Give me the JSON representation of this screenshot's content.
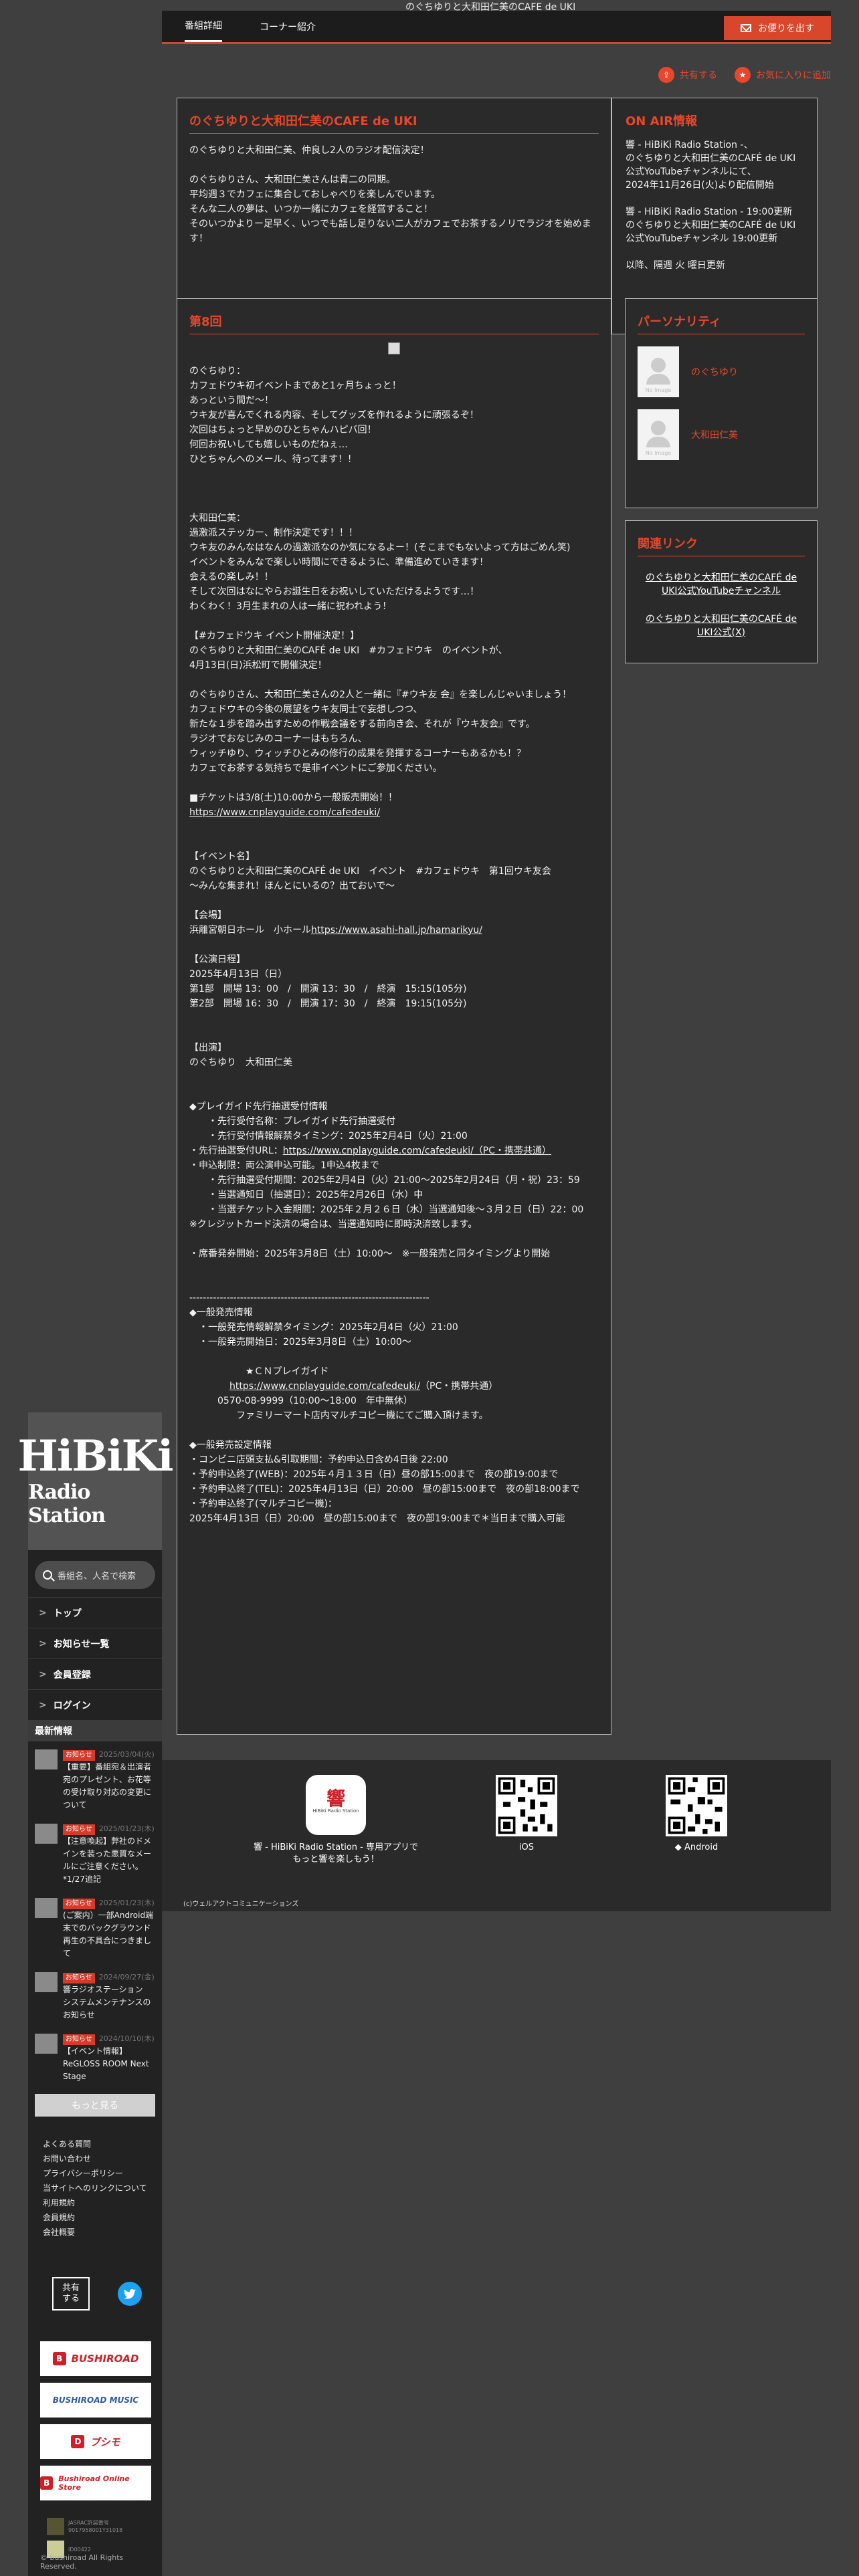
{
  "page": {
    "header_image_alt": "のぐちゆりと大和田仁美のCAFE de UKI"
  },
  "topnav": {
    "tabs": [
      "番組詳細",
      "コーナー紹介"
    ],
    "mail_button": "お便りを出す"
  },
  "actions": {
    "share": "共有する",
    "favorite": "お気に入りに追加"
  },
  "info": {
    "title": "のぐちゆりと大和田仁美のCAFE de UKI",
    "body": "のぐちゆりと大和田仁美、仲良し2人のラジオ配信決定！\n\nのぐちゆりさん、大和田仁美さんは青二の同期。\n平均週３でカフェに集合しておしゃべりを楽しんでいます。\nそんな二人の夢は、いつか一緒にカフェを経営すること！\nそのいつかよりー足早く、いつでも話し足りない二人がカフェでお茶するノリでラジオを始めます！"
  },
  "onair": {
    "title": "ON AIR情報",
    "body": "響 - HiBiKi Radio Station -、\nのぐちゆりと大和田仁美のCAFÉ de UKI公式YouTubeチャンネルにて、\n2024年11月26日(火)より配信開始\n\n響 - HiBiKi Radio Station - 19:00更新\nのぐちゆりと大和田仁美のCAFÉ de UKI公式YouTubeチャンネル 19:00更新\n\n以降、隔週 火 曜日更新"
  },
  "episode": {
    "title": "第8回",
    "block1": "のぐちゆり：\nカフェドウキ初イベントまであと1ヶ月ちょっと！\nあっという間だ〜！\nウキ友が喜んでくれる内容、そしてグッズを作れるように頑張るぞ！\n次回はちょっと早めのひとちゃんハピバ回！\n何回お祝いしても嬉しいものだねぇ…\nひとちゃんへのメール、待ってます！！\n\n\n\n大和田仁美：\n過激派ステッカー、制作決定です！！！\nウキ友のみんなはなんの過激派なのか気になるよー！(そこまでもないよって方はごめん笑)\nイベントをみんなで楽しい時間にできるように、準備進めていきます！\n会えるの楽しみ！！\nそして次回はなにやらお誕生日をお祝いしていただけるようです…！\nわくわく！3月生まれの人は一緒に祝われよう！\n\n【#カフェドウキ イベント開催決定！】\nのぐちゆりと大和田仁美のCAFÉ de UKI　#カフェドウキ　のイベントが、\n4月13日(日)浜松町で開催決定！\n\nのぐちゆりさん、大和田仁美さんの2人と一緒に『#ウキ友 会』を楽しんじゃいましょう！\nカフェドウキの今後の展望をウキ友同士で妄想しつつ、\n新たな１歩を踏み出すための作戦会議をする前向き会、それが『ウキ友会』です。\nラジオでおなじみのコーナーはもちろん、\nウィッチゆり、ウィッチひとみの修行の成果を発揮するコーナーもあるかも！？\nカフェでお茶する気持ちで是非イベントにご参加ください。\n\n■チケットは3/8(土)10:00から一般販売開始！！",
    "link1": "https://www.cnplayguide.com/cafedeuki/",
    "block2": "\n\n【イベント名】\nのぐちゆりと大和田仁美のCAFÉ de UKI　イベント　#カフェドウキ　第1回ウキ友会\n〜みんな集まれ！ほんとにいるの？出ておいで〜\n\n【会場】",
    "venue_prefix": "浜離宮朝日ホール　小ホール",
    "venue_link": "https://www.asahi-hall.jp/hamarikyu/",
    "block3": "\n【公演日程】\n2025年4月13日（日）\n第1部　開場 13：00　/　開演 13：30　/　終演　15:15(105分)\n第2部　開場 16：30　/　開演 17：30　/　終演　19:15(105分)\n\n\n【出演】\nのぐちゆり　大和田仁美\n\n\n◆プレイガイド先行抽選受付情報\n　　・先行受付名称：プレイガイド先行抽選受付\n　　・先行受付情報解禁タイミング：2025年2月4日（火）21:00",
    "presale_prefix": "・先行抽選受付URL：",
    "presale_link": "https://www.cnplayguide.com/cafedeuki/（PC・携帯共通）",
    "block4": "・申込制限：両公演申込可能。1申込4枚まで\n　　・先行抽選受付期間：2025年2月4日（火）21:00〜2025年2月24日（月・祝）23：59\n　　・当選通知日（抽選日）：2025年2月26日（水）中\n　　・当選チケット入金期間：2025年２月２６日（水）当選通知後〜３月２日（日）22：00\n※クレジットカード決済の場合は、当選通知時に即時決済致します。\n\n・席番発券開始：2025年3月8日（土）10:00〜　※一般発売と同タイミングより開始\n\n\n-----------------------------------------------------------------------\n◆一般発売情報\n　・一般発売情報解禁タイミング：2025年2月4日（火）21:00\n　・一般発売開始日：2025年3月8日（土）10:00〜\n\n　　　　　　★ＣＮプレイガイド",
    "cn_link": "https://www.cnplayguide.com/cafedeuki/",
    "cn_link_suffix": "（PC・携帯共通）",
    "block5": "　　　0570-08-9999（10:00〜18:00　年中無休）\n　　　　　ファミリーマート店内マルチコピー機にてご購入頂けます。\n\n◆一般発売設定情報\n・コンビニ店頭支払&引取期間：予約申込日含め4日後 22:00\n・予約申込終了(WEB)：2025年４月１３日（日）昼の部15:00まで　夜の部19:00まで\n・予約申込終了(TEL)：2025年4月13日（日）20:00　昼の部15:00まで　夜の部18:00まで\n・予約申込終了(マルチコピー機)：\n2025年4月13日（日）20:00　昼の部15:00まで　夜の部19:00まで＊当日まで購入可能"
  },
  "personality": {
    "title": "パーソナリティ",
    "no_image": "No Image",
    "people": [
      "のぐちゆり",
      "大和田仁美"
    ]
  },
  "related": {
    "title": "関連リンク",
    "links": [
      "のぐちゆりと大和田仁美のCAFÉ de UKI公式YouTubeチャンネル",
      "のぐちゆりと大和田仁美のCAFÉ de UKI公式(X)"
    ]
  },
  "app_band": {
    "app_text": "響 - HiBiKi Radio Station - 専用アプリで\nもっと響を楽しもう！",
    "app_icon_text": "響",
    "app_icon_sub": "HiBiKi Radio Station",
    "ios": "iOS",
    "android": "Android",
    "credit": "(c)ウェルアクトコミュニケーションズ"
  },
  "sidebar": {
    "logo_main": "HiBiKi",
    "logo_sub": "Radio Station",
    "search_placeholder": "番組名、人名で検索",
    "nav": [
      "トップ",
      "お知らせ一覧",
      "会員登録",
      "ログイン"
    ],
    "news_heading": "最新情報",
    "news": [
      {
        "badge": "お知らせ",
        "date": "2025/03/04(火)",
        "text": "【重要】番組宛＆出演者宛のプレゼント、お花等の受け取り対応の変更について"
      },
      {
        "badge": "お知らせ",
        "date": "2025/01/23(木)",
        "text": "【注意喚起】弊社のドメインを装った悪質なメールにご注意ください。*1/27追記"
      },
      {
        "badge": "お知らせ",
        "date": "2025/01/23(木)",
        "text": "(ご案内）一部Android端末でのバックグラウンド再生の不具合につきまして"
      },
      {
        "badge": "お知らせ",
        "date": "2024/09/27(金)",
        "text": "響ラジオステーション　システムメンテナンスのお知らせ"
      },
      {
        "badge": "お知らせ",
        "date": "2024/10/10(木)",
        "text": "【イベント情報】ReGLOSS ROOM Next Stage"
      }
    ],
    "more": "もっと見る",
    "footer_links": [
      "よくある質問",
      "お問い合わせ",
      "プライバシーポリシー",
      "当サイトへのリンクについて",
      "利用規約",
      "会員規約",
      "会社概要"
    ],
    "share": "共有\nする",
    "banners": [
      "BUSHIROAD",
      "BUSHIROAD MUSIC",
      "ブシモ",
      "Bushiroad Online Store"
    ],
    "jasrac_text": "JASRAC許諾番号\n9017958001Y31018",
    "nextone_text": "ID00422",
    "copyright": "© bushiroad All Rights Reserved."
  },
  "colors": {
    "accent": "#e8472b",
    "background": "#3f3f3f",
    "panel": "#2a2a2a",
    "twitter": "#1da1f2"
  }
}
